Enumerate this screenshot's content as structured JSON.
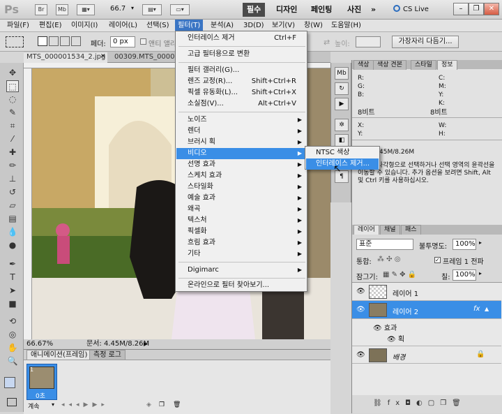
{
  "appbar": {
    "logo": "Ps",
    "zoom": "66.7",
    "workspaces": [
      "필수",
      "디자인",
      "페인팅",
      "사진"
    ],
    "more": "»",
    "cslive": "CS Live"
  },
  "menubar": {
    "items": [
      "파일(F)",
      "편집(E)",
      "이미지(I)",
      "레이어(L)",
      "선택(S)",
      "필터(T)",
      "분석(A)",
      "3D(D)",
      "보기(V)",
      "창(W)",
      "도움말(H)"
    ]
  },
  "options": {
    "feather_label": "페더:",
    "feather_value": "0 px",
    "antialias_label": "앤티 앨리",
    "refine_button": "가장자리 다듬기..."
  },
  "document": {
    "tabs": [
      "MTS_000001534_2.jpg",
      "00309.MTS_00000"
    ],
    "zoom": "66.67%",
    "doc_info": "문서: 4.45M/8.26M"
  },
  "filter_menu": {
    "items": [
      {
        "label": "인터레이스 제거",
        "shortcut": "Ctrl+F"
      },
      {
        "label": "고급 필터용으로 변환"
      },
      {
        "label": "필터 갤러리(G)..."
      },
      {
        "label": "렌즈 교정(R)...",
        "shortcut": "Shift+Ctrl+R"
      },
      {
        "label": "픽셀 유동화(L)...",
        "shortcut": "Shift+Ctrl+X"
      },
      {
        "label": "소실점(V)...",
        "shortcut": "Alt+Ctrl+V"
      },
      {
        "label": "노이즈"
      },
      {
        "label": "렌더"
      },
      {
        "label": "브러시 획"
      },
      {
        "label": "비디오"
      },
      {
        "label": "선명 효과"
      },
      {
        "label": "스케치 효과"
      },
      {
        "label": "스타일화"
      },
      {
        "label": "예술 효과"
      },
      {
        "label": "왜곡"
      },
      {
        "label": "텍스처"
      },
      {
        "label": "픽셀화"
      },
      {
        "label": "흐림 효과"
      },
      {
        "label": "기타"
      },
      {
        "label": "Digimarc"
      },
      {
        "label": "온라인으로 필터 찾아보기..."
      }
    ]
  },
  "video_submenu": {
    "items": [
      "NTSC 색상",
      "인터레이스 제거..."
    ]
  },
  "info_panel": {
    "tabs": [
      "색상",
      "색상 견본",
      "스타일",
      "정보"
    ],
    "rgb": [
      "R:",
      "G:",
      "B:"
    ],
    "cmyk": [
      "C:",
      "M:",
      "Y:",
      "K:"
    ],
    "bit_left": "8비트",
    "bit_right": "8비트",
    "xy": [
      "X:",
      "Y:"
    ],
    "wh": [
      "W:",
      "H:"
    ],
    "doc": "문서: 4.45M/8.26M",
    "hint": "영역을 사각형으로 선택하거나 선택 영역의 윤곽선을 이동할 수 있습니다. 추가 옵션을 보려면 Shift, Alt 및 Ctrl 키를 사용하십시오."
  },
  "layers_panel": {
    "tabs": [
      "레이어",
      "채널",
      "패스"
    ],
    "blend_mode": "표준",
    "opacity_label": "불투명도:",
    "opacity_value": "100%",
    "unify_label": "통합:",
    "propagate_label": "프레임 1 전파",
    "lock_label": "잠그기:",
    "fill_label": "칠:",
    "fill_value": "100%",
    "layers": [
      "레이어 1",
      "레이어 2",
      "배경"
    ],
    "effects_label": "효과",
    "effect_item": "획"
  },
  "animation_panel": {
    "tabs": [
      "애니메이션(프레임)",
      "측정 로그"
    ],
    "frame_number": "1",
    "frame_delay": "0초",
    "loop": "계속"
  }
}
